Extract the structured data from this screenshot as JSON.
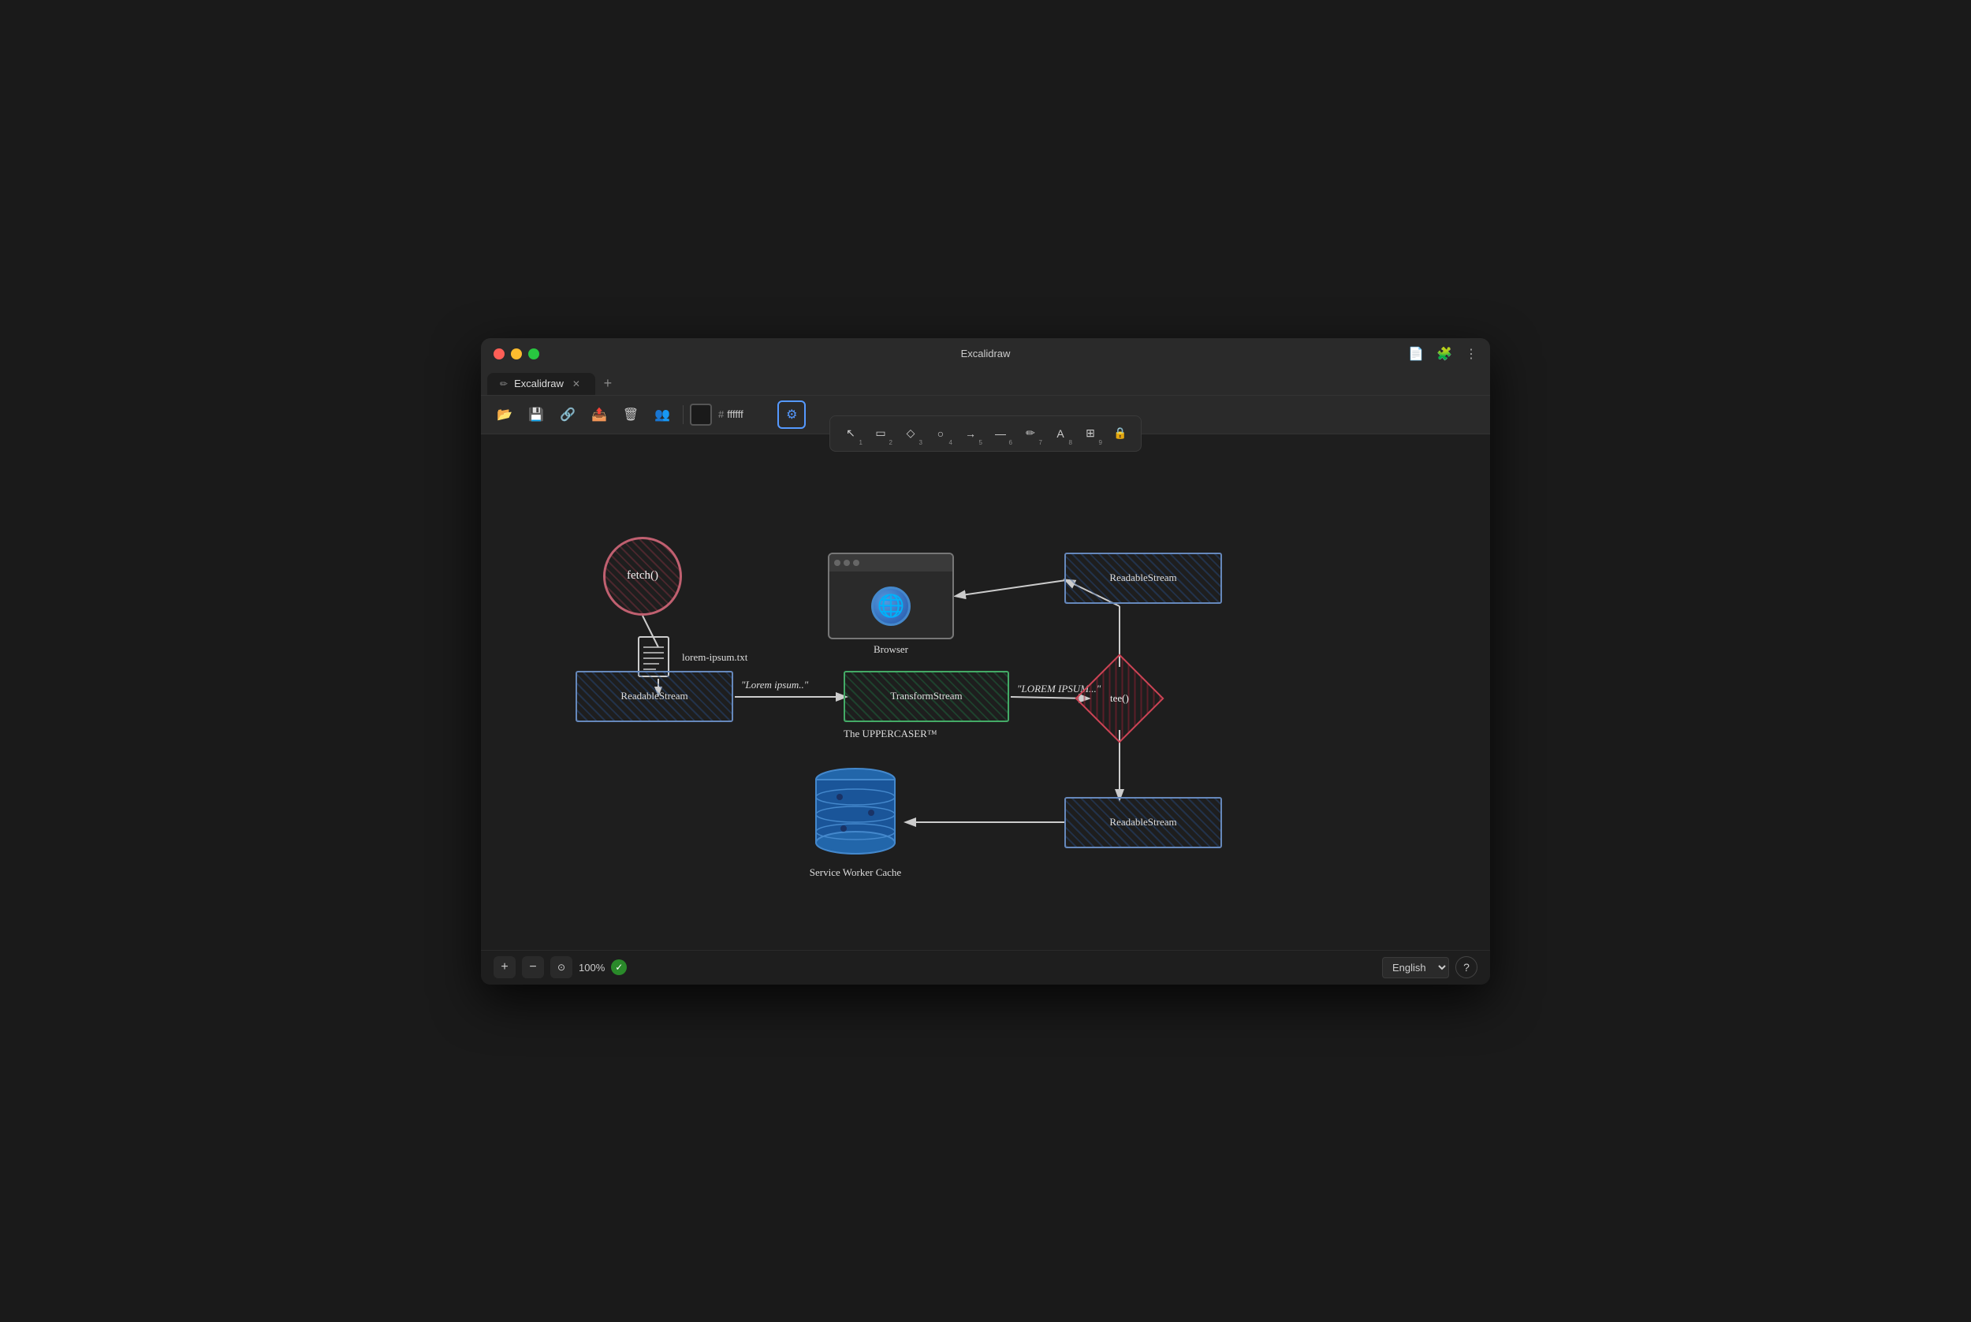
{
  "window": {
    "title": "Excalidraw",
    "tab_label": "Excalidraw"
  },
  "toolbar": {
    "color_value": "ffffff",
    "color_hash": "#",
    "zoom_level": "100%",
    "language": "English"
  },
  "tools": [
    {
      "name": "select",
      "symbol": "↖",
      "num": "1"
    },
    {
      "name": "rectangle",
      "symbol": "□",
      "num": "2"
    },
    {
      "name": "diamond",
      "symbol": "◇",
      "num": "3"
    },
    {
      "name": "ellipse",
      "symbol": "○",
      "num": "4"
    },
    {
      "name": "arrow",
      "symbol": "→",
      "num": "5"
    },
    {
      "name": "line",
      "symbol": "—",
      "num": "6"
    },
    {
      "name": "pencil",
      "symbol": "✏",
      "num": "7"
    },
    {
      "name": "text",
      "symbol": "A",
      "num": "8"
    },
    {
      "name": "image",
      "symbol": "⊞",
      "num": "9"
    },
    {
      "name": "lock",
      "symbol": "🔒",
      "num": ""
    }
  ],
  "diagram": {
    "fetch_label": "fetch()",
    "doc_label": "lorem-ipsum.txt",
    "readable_left_label": "ReadableStream",
    "lorem_ipsum_label": "\"Lorem ipsum..\"",
    "transform_label": "TransformStream",
    "uppercaser_label": "The UPPERCASER™",
    "lorem_upper_label": "\"LOREM IPSUM...\"",
    "tee_label": "tee()",
    "browser_label": "Browser",
    "readable_top_right_label": "ReadableStream",
    "readable_bottom_right_label": "ReadableStream",
    "service_worker_label": "Service Worker Cache"
  },
  "bottom": {
    "zoom": "100%",
    "language": "English"
  }
}
